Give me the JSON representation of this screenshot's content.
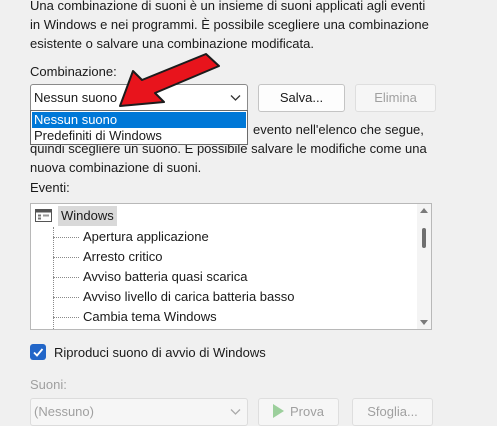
{
  "intro_lines": [
    "Una combinazione di suoni è un insieme di suoni applicati agli eventi",
    "in Windows e nei programmi. È possibile scegliere una combinazione",
    "esistente o salvare una combinazione modificata."
  ],
  "combination": {
    "label": "Combinazione:",
    "selected": "Nessun suono",
    "options": [
      "Nessun suono",
      "Predefiniti di Windows"
    ],
    "save_button": "Salva...",
    "delete_button": "Elimina"
  },
  "description_lines": [
    "evento nell'elenco che segue,",
    "quindi scegliere un suono. È possibile salvare le modifiche come una",
    "nuova combinazione di suoni."
  ],
  "events": {
    "label": "Eventi:",
    "root": "Windows",
    "items": [
      "Apertura applicazione",
      "Arresto critico",
      "Avviso batteria quasi scarica",
      "Avviso livello di carica batteria basso",
      "Cambia tema Windows"
    ]
  },
  "startup_sound": {
    "label": "Riproduci suono di avvio di Windows",
    "checked": true
  },
  "sounds": {
    "label": "Suoni:",
    "selected": "(Nessuno)",
    "test_button": "Prova",
    "browse_button": "Sfoglia..."
  },
  "colors": {
    "accent": "#0078d7",
    "checkbox": "#2266c8",
    "annotation_arrow": "#e8141c"
  }
}
